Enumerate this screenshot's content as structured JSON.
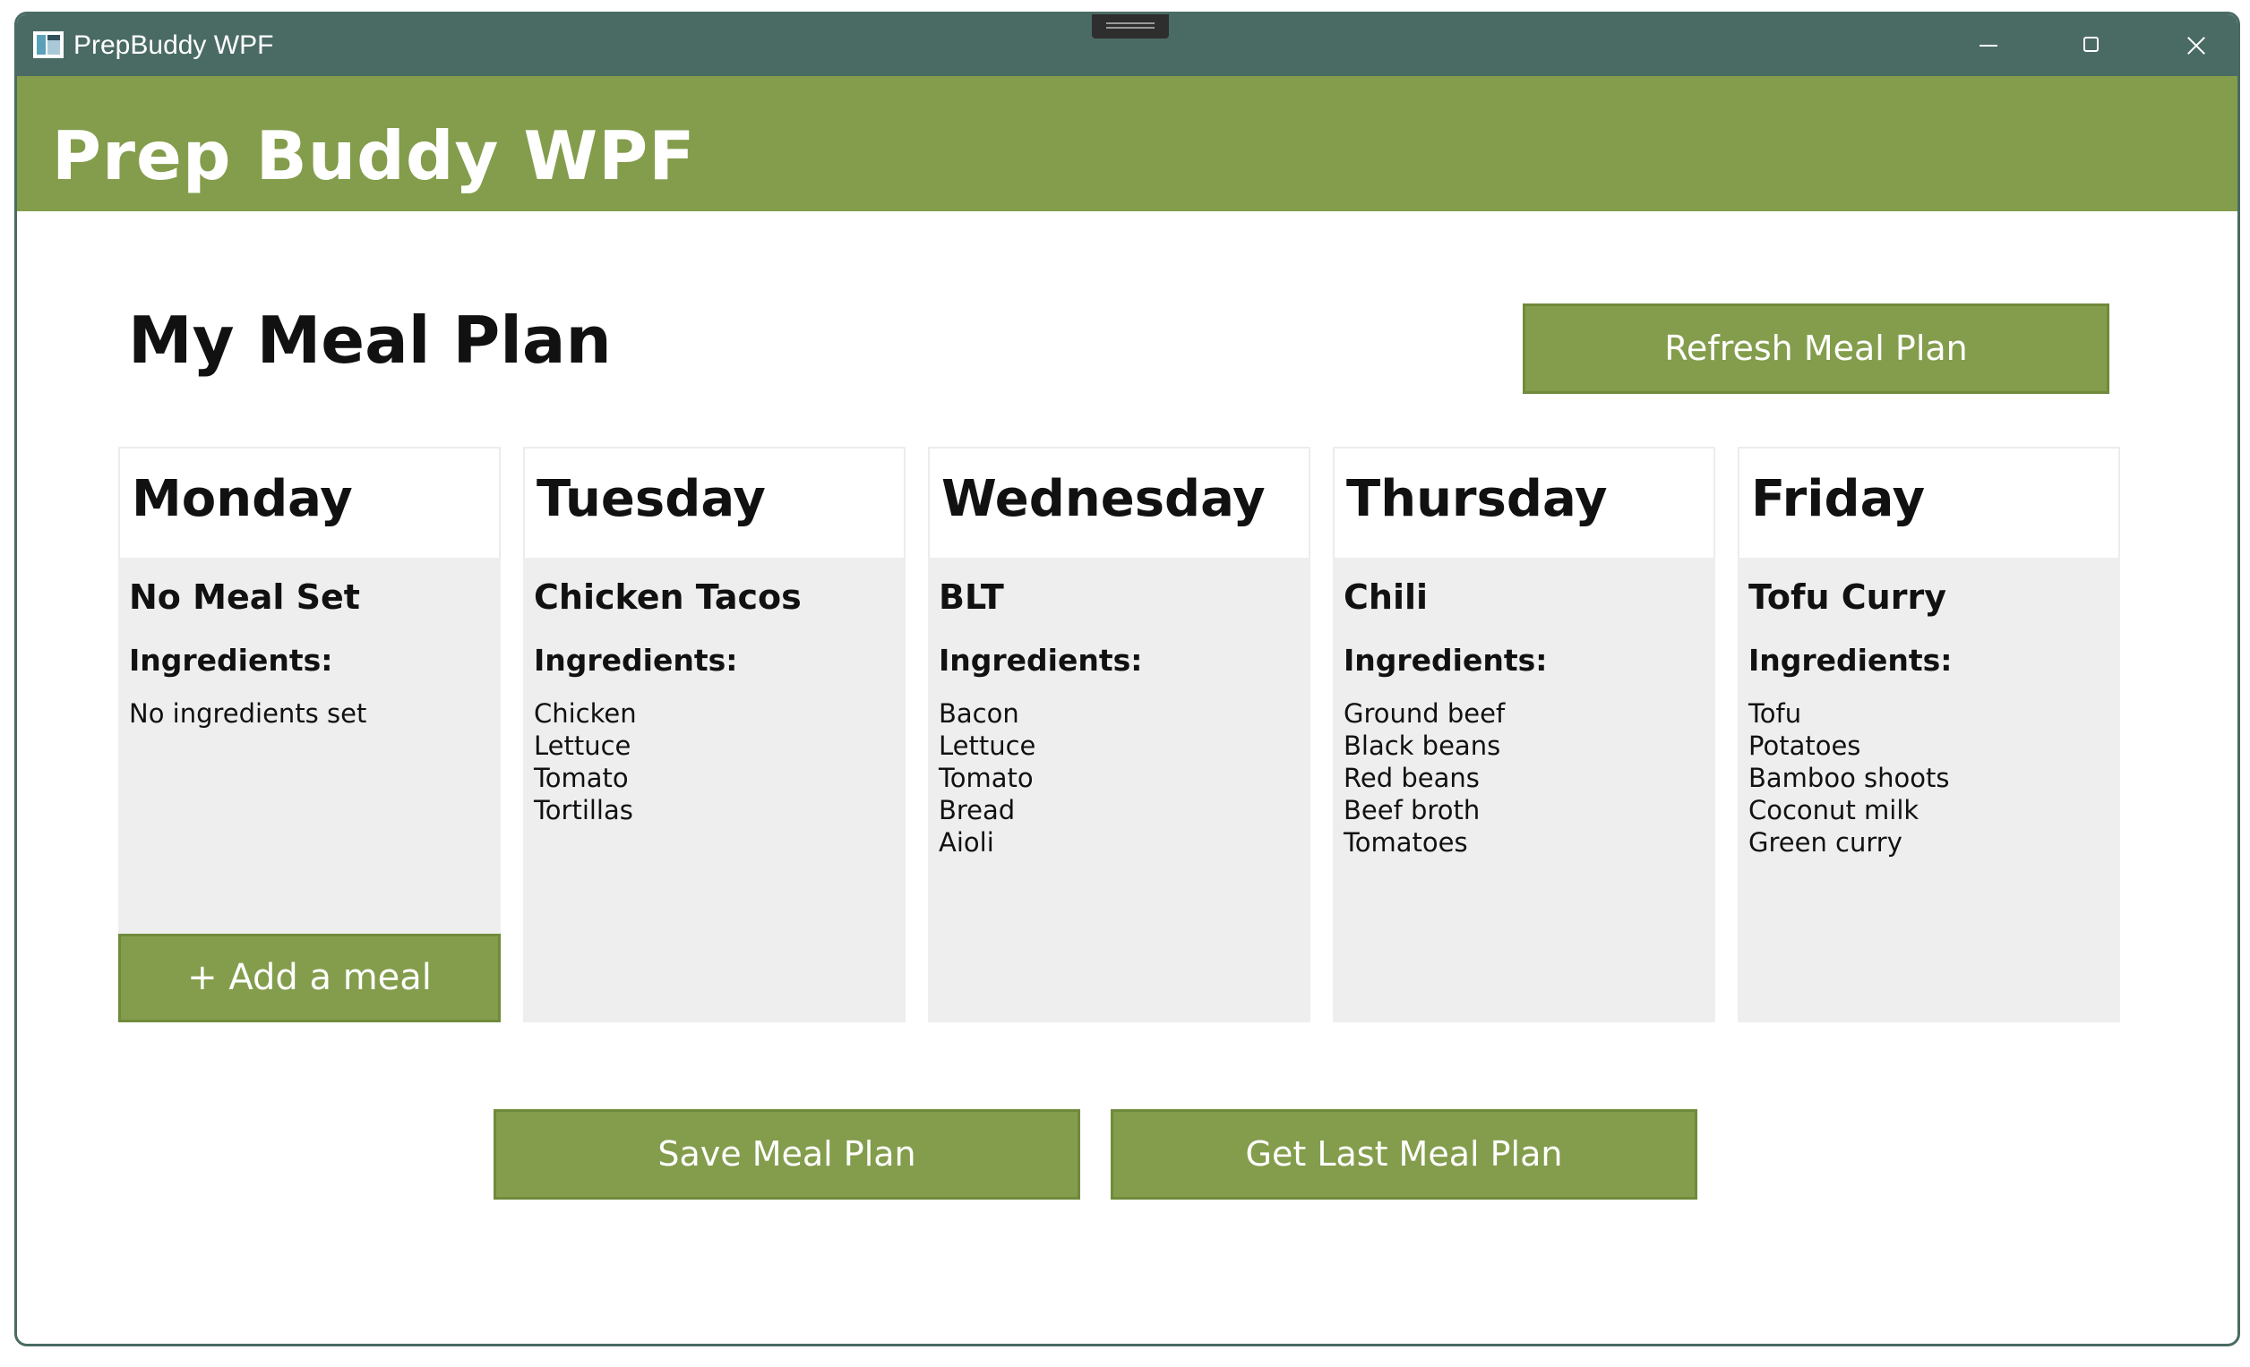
{
  "window": {
    "title": "PrepBuddy WPF"
  },
  "header": {
    "app_title": "Prep Buddy WPF"
  },
  "main": {
    "page_title": "My Meal Plan",
    "refresh_label": "Refresh Meal Plan",
    "save_label": "Save Meal Plan",
    "get_last_label": "Get Last Meal Plan",
    "ingredients_label": "Ingredients:",
    "add_meal_label": "+ Add a meal",
    "days": [
      {
        "day": "Monday",
        "meal": "No Meal Set",
        "ingredients": [
          "No ingredients set"
        ]
      },
      {
        "day": "Tuesday",
        "meal": "Chicken Tacos",
        "ingredients": [
          "Chicken",
          "Lettuce",
          "Tomato",
          "Tortillas"
        ]
      },
      {
        "day": "Wednesday",
        "meal": "BLT",
        "ingredients": [
          "Bacon",
          "Lettuce",
          "Tomato",
          "Bread",
          "Aioli"
        ]
      },
      {
        "day": "Thursday",
        "meal": "Chili",
        "ingredients": [
          "Ground beef",
          "Black beans",
          "Red beans",
          "Beef broth",
          "Tomatoes"
        ]
      },
      {
        "day": "Friday",
        "meal": "Tofu Curry",
        "ingredients": [
          "Tofu",
          "Potatoes",
          "Bamboo shoots",
          "Coconut milk",
          "Green curry"
        ]
      }
    ]
  },
  "colors": {
    "titlebar": "#4a6b64",
    "accent": "#839d4c",
    "card_bg": "#eeeeee"
  }
}
